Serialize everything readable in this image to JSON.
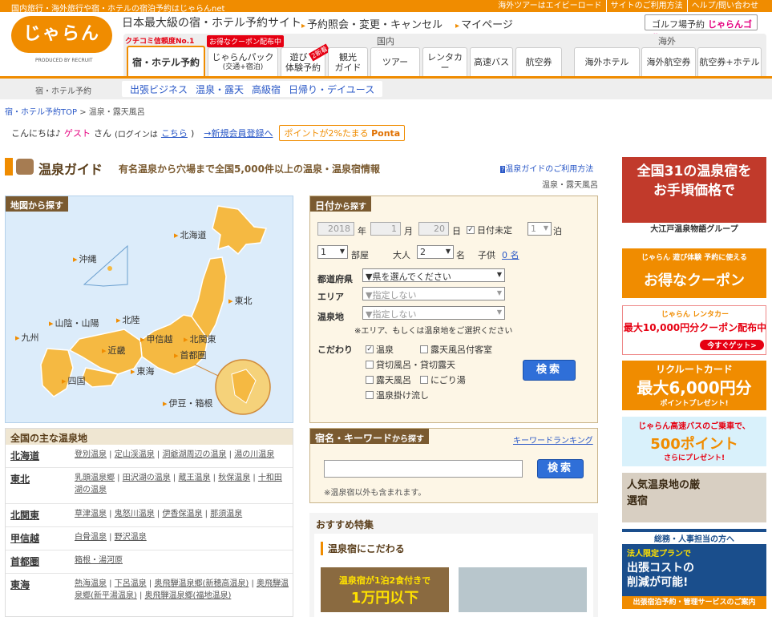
{
  "topbar": {
    "left": "国内旅行・海外旅行や宿・ホテルの宿泊予約はじゃらんnet",
    "links": [
      "海外ツアーはエイビーロード",
      "サイトのご利用方法",
      "ヘルプ/問い合わせ"
    ]
  },
  "header": {
    "logo_text": "じゃらん",
    "produced_by": "PRODUCED BY RECRUIT",
    "tagline": "日本最大級の宿・ホテル予約サイト",
    "links": [
      "予約照会・変更・キャンセル",
      "マイページ"
    ],
    "golf_label": "ゴルフ場予約",
    "golf_brand": "じゃらんゴルフ"
  },
  "nav": {
    "domestic_title": "国内",
    "overseas_title": "海外",
    "badge_review": "クチコミ信頼度No.1",
    "badge_coupon": "お得なクーポン配布中",
    "new_badge": "2新着",
    "domestic_tabs": [
      {
        "label": "宿・ホテル予約",
        "sub": ""
      },
      {
        "label": "じゃらんパック",
        "sub": "(交通+宿泊)"
      },
      {
        "label": "遊び・",
        "sub": "体験予約"
      },
      {
        "label": "観光",
        "sub": "ガイド"
      },
      {
        "label": "ツアー",
        "sub": ""
      },
      {
        "label": "レンタカー",
        "sub": ""
      },
      {
        "label": "高速バス",
        "sub": ""
      },
      {
        "label": "航空券",
        "sub": ""
      }
    ],
    "overseas_tabs": [
      "海外ホテル",
      "海外航空券",
      "航空券+ホテル"
    ]
  },
  "subnav": {
    "current": "宿・ホテル予約",
    "links": [
      "出張ビジネス",
      "温泉・露天",
      "高級宿",
      "日帰り・デイユース"
    ]
  },
  "breadcrumb": {
    "home": "宿・ホテル予約TOP",
    "sep": ">",
    "current": "温泉・露天風呂"
  },
  "greeting": {
    "hello": "こんにちは♪",
    "guest": "ゲスト",
    "san": "さん",
    "login_prefix": "(ログインは",
    "login_link": "こちら",
    "login_suffix": ")",
    "register": "→新規会員登録へ",
    "ponta_prefix": "ポイントが2%たまる",
    "ponta_brand": "Ponta"
  },
  "guide": {
    "title": "温泉ガイド",
    "subtitle": "有名温泉から穴場まで全国5,000件以上の温泉・温泉宿情報",
    "howto": "温泉ガイドのご利用方法",
    "label": "温泉・露天風呂"
  },
  "map": {
    "head": "地図から探す",
    "regions": [
      "北海道",
      "東北",
      "北関東",
      "首都圏",
      "甲信越",
      "北陸",
      "東海",
      "近畿",
      "山陰・山陽",
      "九州",
      "四国",
      "沖縄",
      "伊豆・箱根"
    ]
  },
  "date_search": {
    "head_strong": "日付",
    "head_rest": "から探す",
    "year": "2018",
    "year_unit": "年",
    "month": "1",
    "month_unit": "月",
    "day": "20",
    "day_unit": "日",
    "undecided": "日付未定",
    "nights": "1",
    "nights_unit": "泊",
    "rooms": "1",
    "rooms_unit": "部屋",
    "adults_label": "大人",
    "adults": "2",
    "adults_unit": "名",
    "child_label": "子供",
    "child_value": "0 名",
    "pref_label": "都道府県",
    "pref_value": "▼県を選んでください",
    "area_label": "エリア",
    "area_value": "▼指定しない",
    "onsen_label": "温泉地",
    "onsen_value": "▼指定しない",
    "note": "※エリア、もしくは温泉地をご選択ください",
    "pref_title": "こだわり",
    "prefs": [
      "温泉",
      "露天風呂付客室",
      "貸切風呂・貸切露天",
      "露天風呂",
      "にごり湯",
      "温泉掛け流し"
    ],
    "search_button": "検索"
  },
  "keyword": {
    "head_strong": "宿名・キーワード",
    "head_rest": "から探す",
    "ranking": "キーワードランキング",
    "search_button": "検索",
    "note": "※温泉宿以外も含まれます。"
  },
  "featured": {
    "head": "おすすめ特集",
    "sub": "温泉宿にこだわる",
    "banner_line1": "温泉宿が1泊2食付きで",
    "banner_line2": "1万円以下"
  },
  "onsen_list": {
    "head": "全国の主な温泉地",
    "regions": [
      {
        "name": "北海道",
        "spots": [
          "登別温泉",
          "定山渓温泉",
          "洞爺湖周辺の温泉",
          "湯の川温泉"
        ]
      },
      {
        "name": "東北",
        "spots": [
          "乳頭温泉郷",
          "田沢湖の温泉",
          "蔵王温泉",
          "秋保温泉",
          "十和田湖の温泉"
        ]
      },
      {
        "name": "北関東",
        "spots": [
          "草津温泉",
          "鬼怒川温泉",
          "伊香保温泉",
          "那須温泉"
        ]
      },
      {
        "name": "甲信越",
        "spots": [
          "白骨温泉",
          "野沢温泉"
        ]
      },
      {
        "name": "首都圏",
        "spots": [
          "箱根・湯河原"
        ]
      },
      {
        "name": "東海",
        "spots": [
          "熱海温泉",
          "下呂温泉",
          "奥飛騨温泉郷(新穂高温泉)",
          "奥飛騨温泉郷(新平湯温泉)",
          "奥飛騨温泉郷(福地温泉)"
        ]
      }
    ]
  },
  "banners": {
    "b1_line1": "全国31の温泉宿を",
    "b1_line2": "お手頃価格で",
    "b1_footer": "大江戸温泉物語グループ",
    "b2_top": "じゃらん 遊び体験 予約に使える",
    "b2_main": "お得なクーポン",
    "b3_top": "じゃらん レンタカー",
    "b3_main": "最大10,000円分クーポン配布中",
    "b3_cta": "今すぐゲット>",
    "b4_top": "リクルートカード",
    "b4_main": "最大6,000円分",
    "b4_sub": "ポイントプレゼント!",
    "b5_top": "じゃらん高速バスのご乗車で、",
    "b5_main": "500ポイント",
    "b5_sub": "さらにプレゼント!",
    "b6_main": "人気温泉地の厳選宿",
    "b7_top": "総務・人事担当の方へ",
    "b7_sub": "法人限定プランで",
    "b7_main1": "出張コストの",
    "b7_main2": "削減が可能!",
    "b7_footer": "出張宿泊予約・管理サービスのご案内"
  },
  "colors": {
    "brand_orange": "#f08c00",
    "brown": "#7a5a30",
    "link_blue": "#2a58c7",
    "button_blue": "#2f6fd8",
    "map_land": "#f5b942"
  }
}
